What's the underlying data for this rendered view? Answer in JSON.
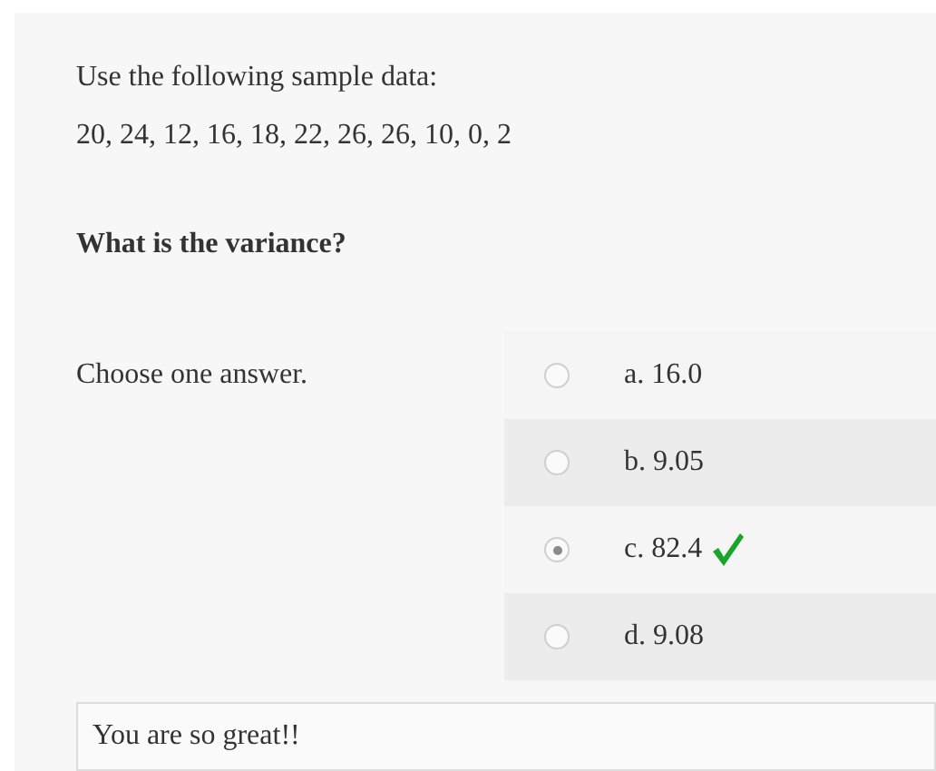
{
  "question": {
    "intro": "Use the following sample data:",
    "data_line": "20, 24, 12, 16, 18, 22, 26, 26, 10, 0, 2",
    "prompt": "What is the variance?"
  },
  "instruction": "Choose one answer.",
  "options": [
    {
      "label": "a. 16.0",
      "selected": false,
      "correct": false
    },
    {
      "label": "b. 9.05",
      "selected": false,
      "correct": false
    },
    {
      "label": "c. 82.4",
      "selected": true,
      "correct": true
    },
    {
      "label": "d. 9.08",
      "selected": false,
      "correct": false
    }
  ],
  "feedback": "You are so great!!"
}
